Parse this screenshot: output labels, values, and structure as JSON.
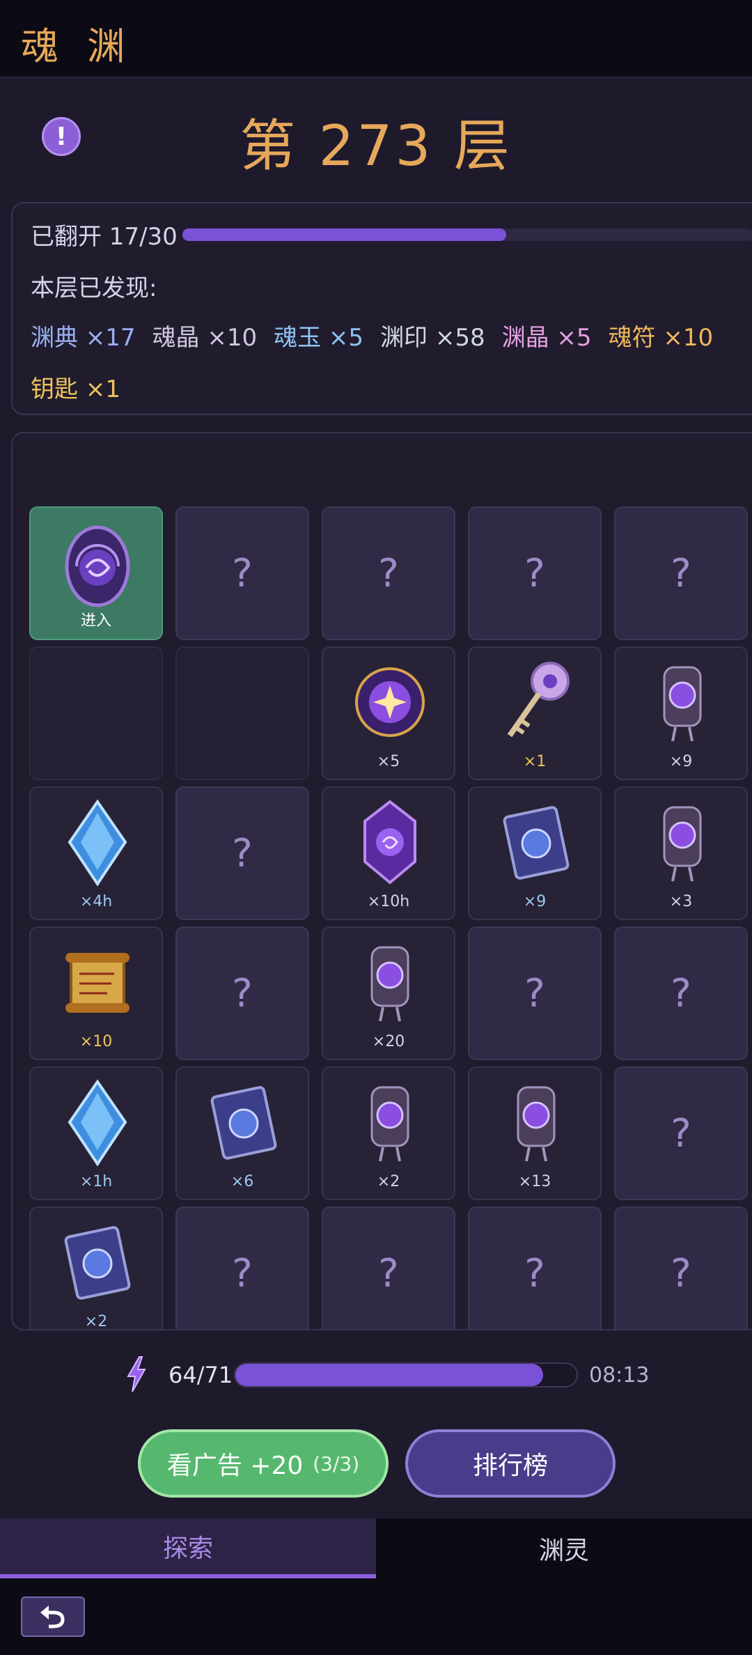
{
  "app": {
    "title": "魂 渊"
  },
  "floor": {
    "title": "第 273 层"
  },
  "progress": {
    "flipped_text": "已翻开 17/30",
    "flipped": 17,
    "total": 30,
    "found_label": "本层已发现:",
    "found_items": [
      {
        "text": "渊典 ×17",
        "color": "#9ab0f0"
      },
      {
        "text": "魂晶 ×10",
        "color": "#cfc8dc"
      },
      {
        "text": "魂玉 ×5",
        "color": "#8ec4f2"
      },
      {
        "text": "渊印 ×58",
        "color": "#cfd8e0"
      },
      {
        "text": "渊晶 ×5",
        "color": "#e6a0e0"
      },
      {
        "text": "魂符 ×10",
        "color": "#f0b85a"
      },
      {
        "text": "钥匙 ×1",
        "color": "#f0c35a"
      }
    ]
  },
  "grid": {
    "cells": [
      {
        "kind": "enter",
        "icon": "portal-icon",
        "label": "进入"
      },
      {
        "kind": "hidden",
        "label": "?"
      },
      {
        "kind": "hidden",
        "label": "?"
      },
      {
        "kind": "hidden",
        "label": "?"
      },
      {
        "kind": "hidden",
        "label": "?"
      },
      {
        "kind": "empty"
      },
      {
        "kind": "empty"
      },
      {
        "kind": "item",
        "icon": "orb-icon",
        "label": "×5"
      },
      {
        "kind": "item",
        "icon": "key-icon",
        "label": "×1"
      },
      {
        "kind": "item",
        "icon": "talisman-icon",
        "label": "×9"
      },
      {
        "kind": "item",
        "icon": "blue-crystal-icon",
        "label": "×4h"
      },
      {
        "kind": "hidden",
        "label": "?"
      },
      {
        "kind": "item",
        "icon": "purple-crystal-icon",
        "label": "×10h"
      },
      {
        "kind": "item",
        "icon": "book-icon",
        "label": "×9"
      },
      {
        "kind": "item",
        "icon": "talisman-icon",
        "label": "×3"
      },
      {
        "kind": "item",
        "icon": "scroll-icon",
        "label": "×10"
      },
      {
        "kind": "hidden",
        "label": "?"
      },
      {
        "kind": "item",
        "icon": "talisman-icon",
        "label": "×20"
      },
      {
        "kind": "hidden",
        "label": "?"
      },
      {
        "kind": "hidden",
        "label": "?"
      },
      {
        "kind": "item",
        "icon": "blue-crystal-icon",
        "label": "×1h"
      },
      {
        "kind": "item",
        "icon": "book-icon",
        "label": "×6"
      },
      {
        "kind": "item",
        "icon": "talisman-icon",
        "label": "×2"
      },
      {
        "kind": "item",
        "icon": "talisman-icon",
        "label": "×13"
      },
      {
        "kind": "hidden",
        "label": "?"
      },
      {
        "kind": "item",
        "icon": "book-icon",
        "label": "×2"
      },
      {
        "kind": "hidden",
        "label": "?"
      },
      {
        "kind": "hidden",
        "label": "?"
      },
      {
        "kind": "hidden",
        "label": "?"
      },
      {
        "kind": "hidden",
        "label": "?"
      }
    ]
  },
  "energy": {
    "text": "64/71",
    "current": 64,
    "max": 71,
    "timer": "08:13",
    "icon": "energy-bolt-icon"
  },
  "buttons": {
    "ad_label": "看广告 +20",
    "ad_sub": "(3/3)",
    "rank_label": "排行榜"
  },
  "tabs": {
    "explore": "探索",
    "spirit": "渊灵"
  },
  "nav": {
    "back_icon": "back-icon"
  }
}
